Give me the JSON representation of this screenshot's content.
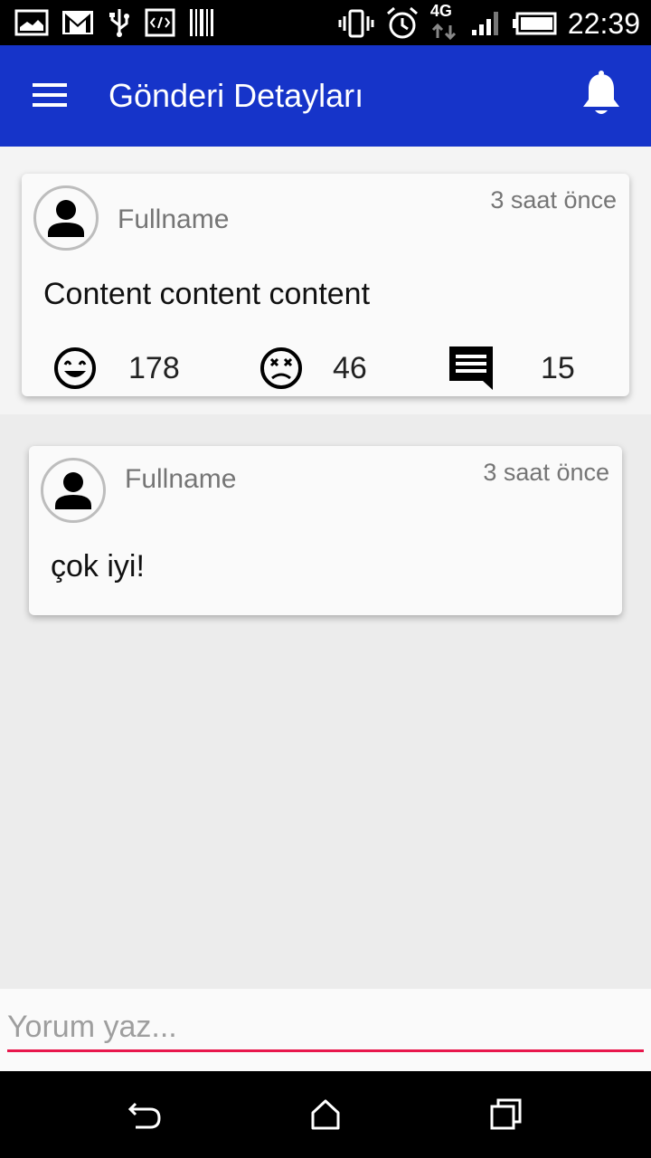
{
  "status_bar": {
    "time": "22:39",
    "network": "4G",
    "icons": [
      "gallery-icon",
      "gmail-icon",
      "usb-icon",
      "developer-icon",
      "barcode-icon",
      "vibrate-icon",
      "alarm-icon",
      "data-transfer-icon",
      "signal-icon",
      "battery-icon"
    ]
  },
  "app_bar": {
    "title": "Gönderi Detayları",
    "menu_icon": "menu-icon",
    "notifications_icon": "bell-icon"
  },
  "post": {
    "author": "Fullname",
    "time_ago": "3 saat önce",
    "content": "Content content content",
    "reactions": [
      {
        "icon": "happy-face-icon",
        "count": "178"
      },
      {
        "icon": "dead-face-icon",
        "count": "46"
      },
      {
        "icon": "comment-icon",
        "count": "15"
      }
    ]
  },
  "comments": [
    {
      "author": "Fullname",
      "time_ago": "3 saat önce",
      "content": "çok iyi!"
    }
  ],
  "comment_input": {
    "placeholder": "Yorum yaz...",
    "value": ""
  },
  "nav_bar": {
    "icons": [
      "back-icon",
      "home-icon",
      "recents-icon"
    ]
  },
  "colors": {
    "app_bar": "#1634c9",
    "input_underline": "#e8174c",
    "secondary_text": "#757575"
  }
}
